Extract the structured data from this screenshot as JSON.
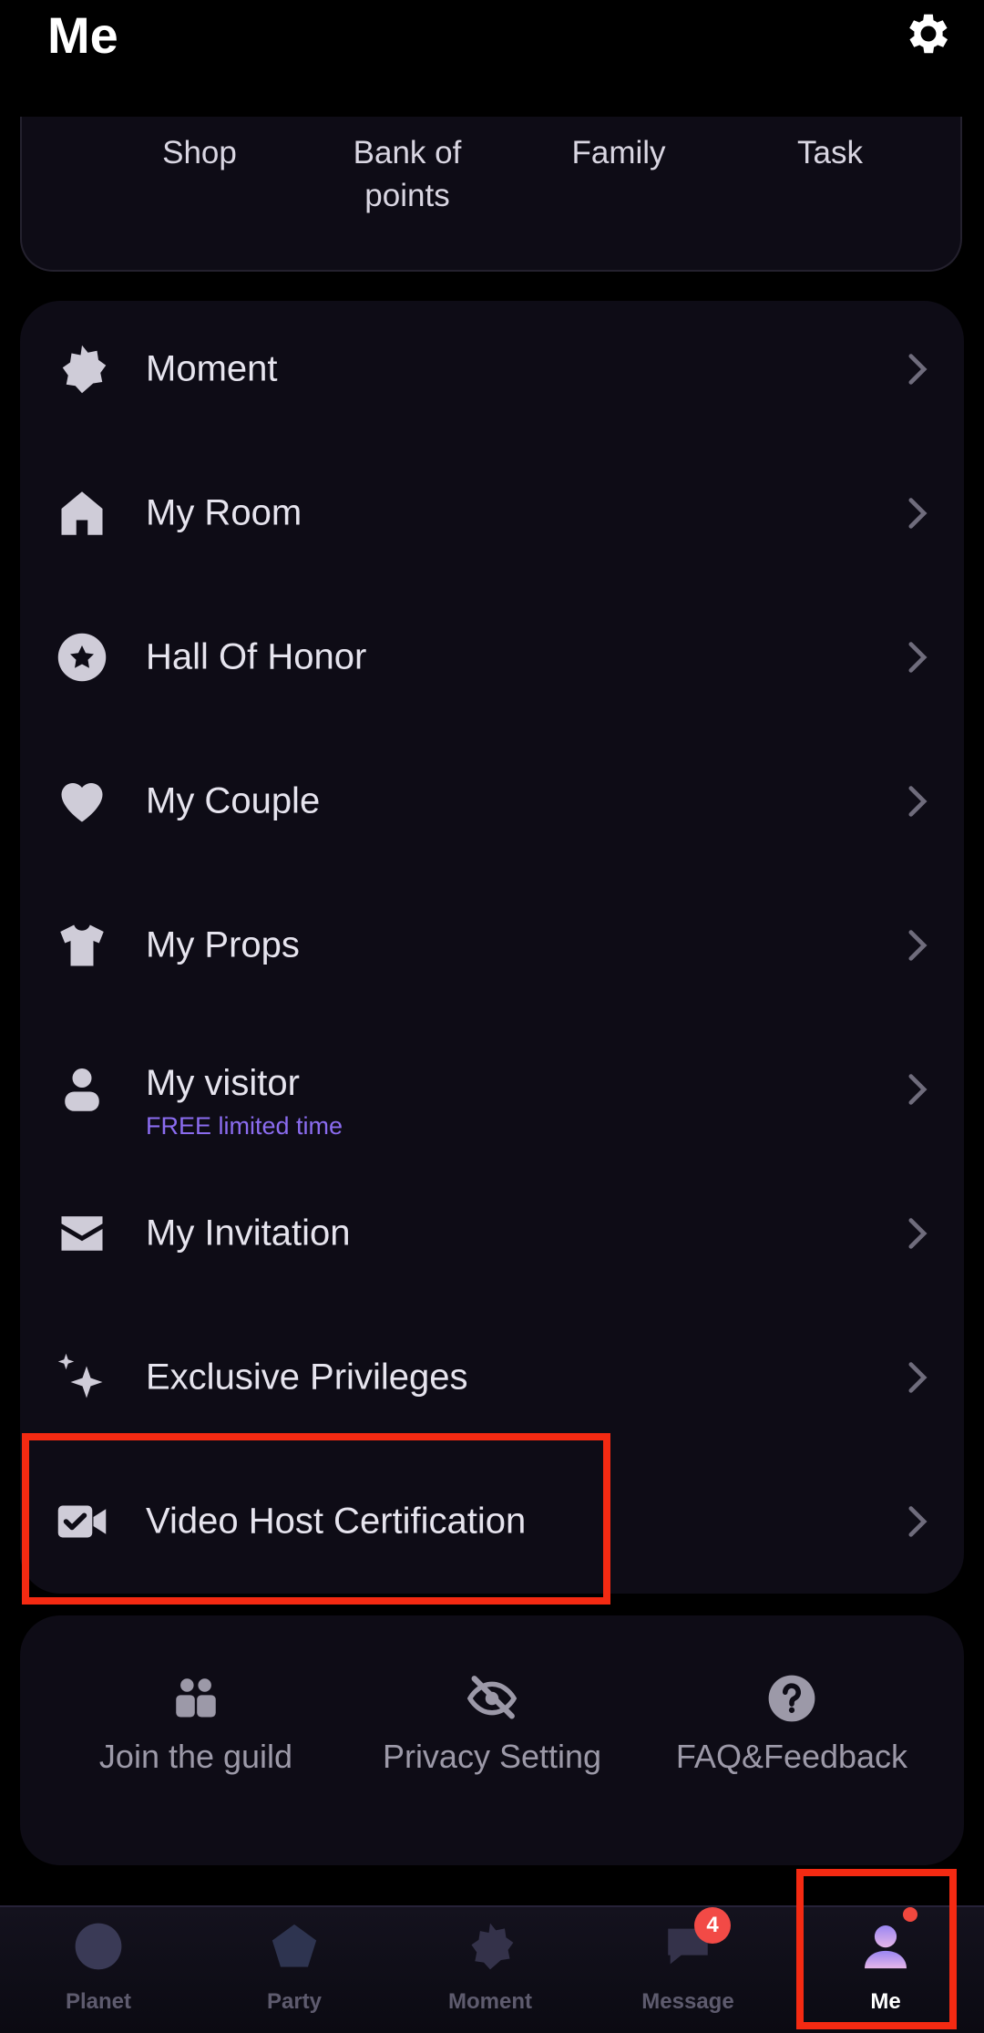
{
  "header": {
    "title": "Me",
    "settings_icon": "gear-icon"
  },
  "shortcuts": [
    "Shop",
    "Bank of\npoints",
    "Family",
    "Task"
  ],
  "menu": [
    {
      "label": "Moment",
      "icon": "moment-badge-icon"
    },
    {
      "label": "My Room",
      "icon": "home-icon"
    },
    {
      "label": "Hall Of Honor",
      "icon": "star-medal-icon"
    },
    {
      "label": "My Couple",
      "icon": "heart-icon"
    },
    {
      "label": "My Props",
      "icon": "tshirt-icon"
    },
    {
      "label": "My visitor",
      "sub": "FREE limited time",
      "icon": "person-icon"
    },
    {
      "label": "My Invitation",
      "icon": "envelope-icon"
    },
    {
      "label": "Exclusive Privileges",
      "icon": "sparkle-icon"
    },
    {
      "label": "Video Host Certification",
      "icon": "video-check-icon"
    }
  ],
  "tools": [
    {
      "label": "Join the guild",
      "icon": "guild-icon"
    },
    {
      "label": "Privacy Setting",
      "icon": "eye-off-icon"
    },
    {
      "label": "FAQ&Feedback",
      "icon": "question-icon"
    }
  ],
  "tabbar": {
    "tabs": [
      {
        "label": "Planet",
        "icon": "planet-icon"
      },
      {
        "label": "Party",
        "icon": "pentagon-icon"
      },
      {
        "label": "Moment",
        "icon": "moment-badge-icon"
      },
      {
        "label": "Message",
        "icon": "chat-icon",
        "badge": "4"
      },
      {
        "label": "Me",
        "icon": "person-icon",
        "active": true,
        "dot": true
      }
    ]
  },
  "colors": {
    "accent": "#8b6cf0",
    "highlight": "#f42a12",
    "badge": "#f24a46",
    "card": "#0e0c16"
  }
}
